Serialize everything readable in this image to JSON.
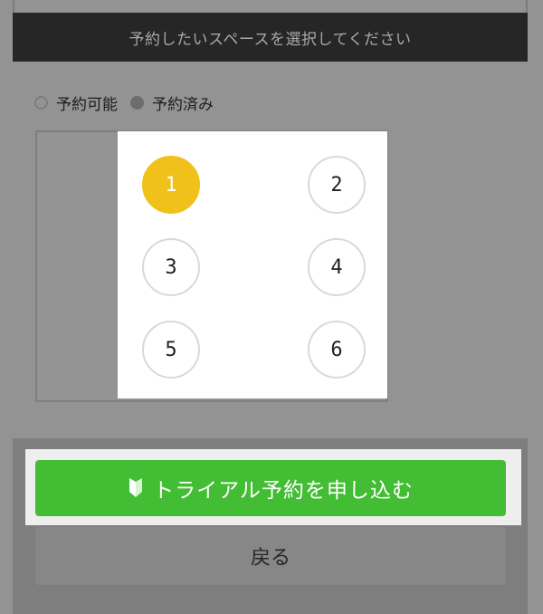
{
  "header": {
    "title": "予約したいスペースを選択してください"
  },
  "legend": {
    "available_label": "予約可能",
    "reserved_label": "予約済み"
  },
  "seats": {
    "s1": "1",
    "s2": "2",
    "s3": "3",
    "s4": "4",
    "s5": "5",
    "s6": "6",
    "selected": "1"
  },
  "actions": {
    "trial_label": "トライアル予約を申し込む",
    "back_label": "戻る"
  },
  "colors": {
    "selected_seat": "#f1c11b",
    "cta": "#43bd33",
    "header_bg": "#262626"
  },
  "icons": {
    "cta_icon": "beginner-mark-icon"
  }
}
